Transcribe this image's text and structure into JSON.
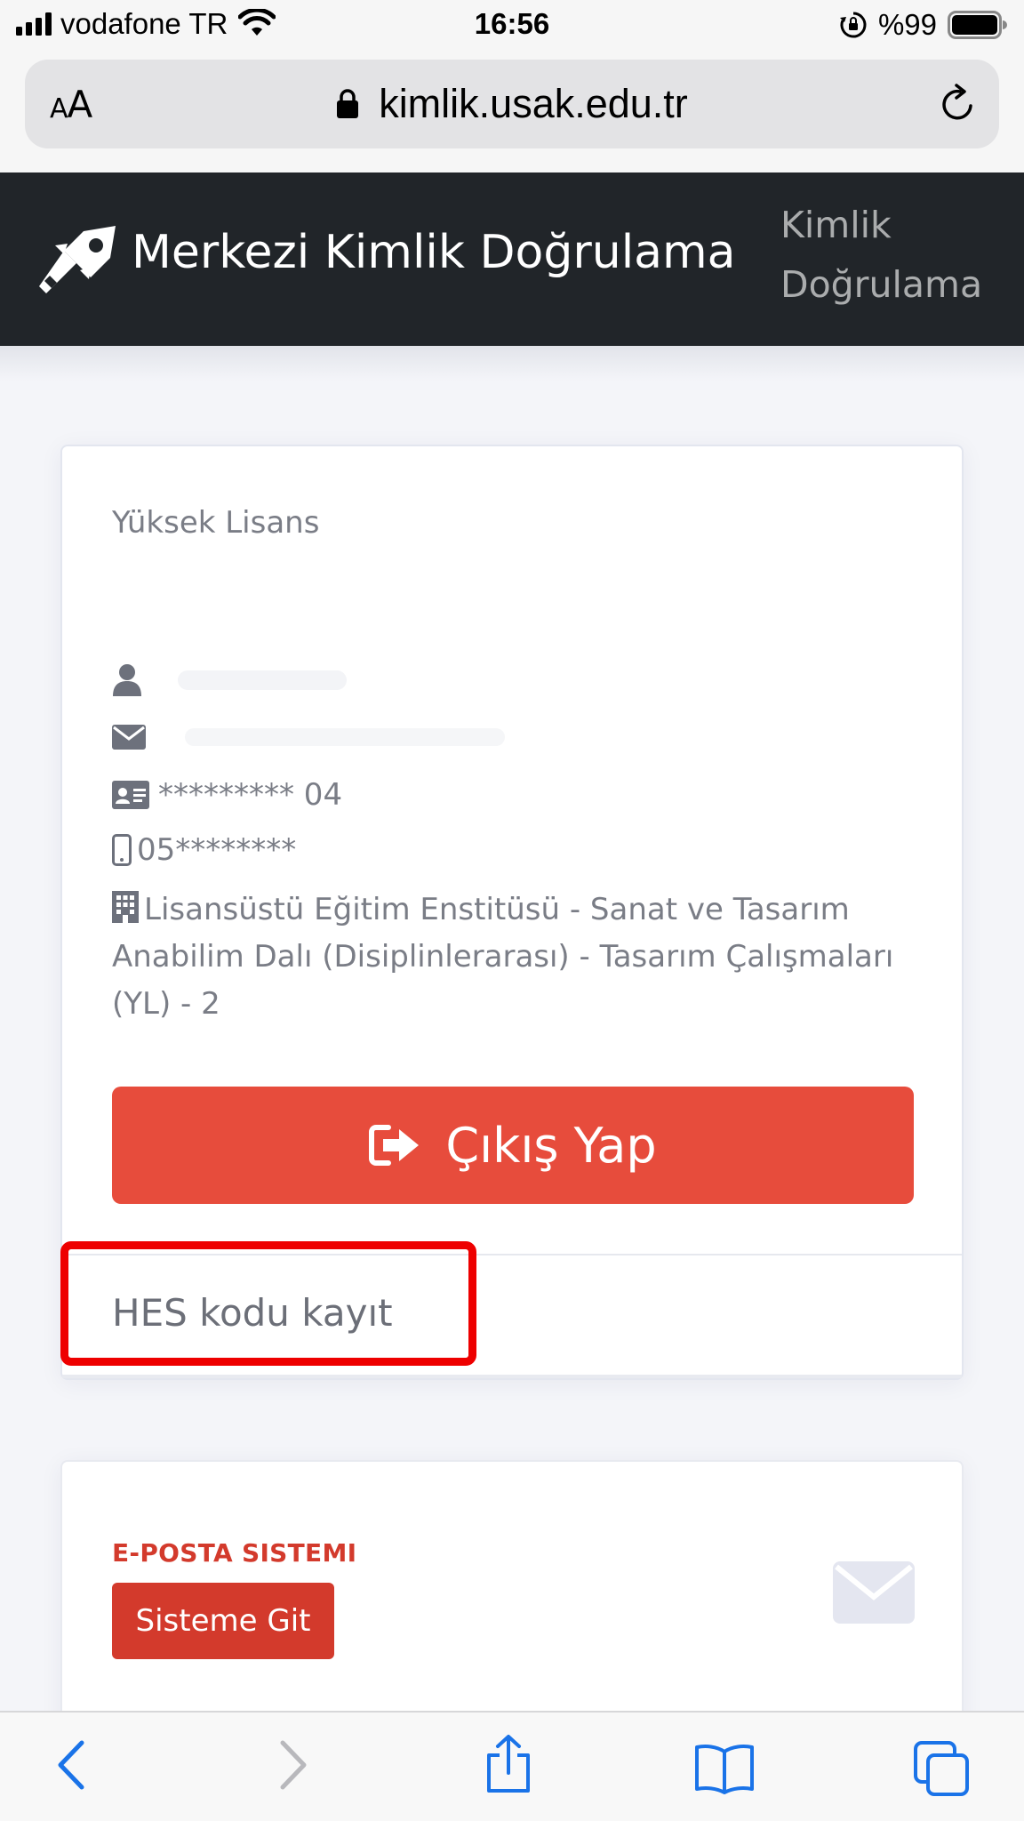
{
  "status_bar": {
    "carrier": "vodafone TR",
    "time": "16:56",
    "battery": "%99"
  },
  "browser": {
    "text_size_label_small": "A",
    "text_size_label_large": "A",
    "url": "kimlik.usak.edu.tr"
  },
  "header": {
    "brand_title": "Merkezi Kimlik Doğrulama",
    "nav_link_line1": "Kimlik",
    "nav_link_line2": "Doğrulama"
  },
  "profile": {
    "degree": "Yüksek Lisans",
    "id_number": "********* 04",
    "phone": "05********",
    "department": "Lisansüstü Eğitim Enstitüsü - Sanat ve Tasarım Anabilim Dalı (Disiplinlerarası) - Tasarım Çalışmaları (YL) - 2",
    "logout_label": "Çıkış Yap",
    "hes_link": "HES kodu kayıt"
  },
  "email_system": {
    "title": "E-POSTA SISTEMI",
    "button_label": "Sisteme Git"
  },
  "colors": {
    "header_bg": "#212529",
    "logout_red": "#e74c3c",
    "email_red": "#d33a2c",
    "ios_blue": "#1a73e8"
  },
  "icons": [
    "signal-icon",
    "wifi-icon",
    "orientation-lock-icon",
    "battery-icon",
    "padlock-icon",
    "reload-icon",
    "rocket-key-icon",
    "user-icon",
    "envelope-icon",
    "id-card-icon",
    "mobile-phone-icon",
    "building-icon",
    "sign-out-icon",
    "envelope-large-icon",
    "back-icon",
    "forward-icon",
    "share-icon",
    "bookmarks-icon",
    "tabs-icon"
  ]
}
